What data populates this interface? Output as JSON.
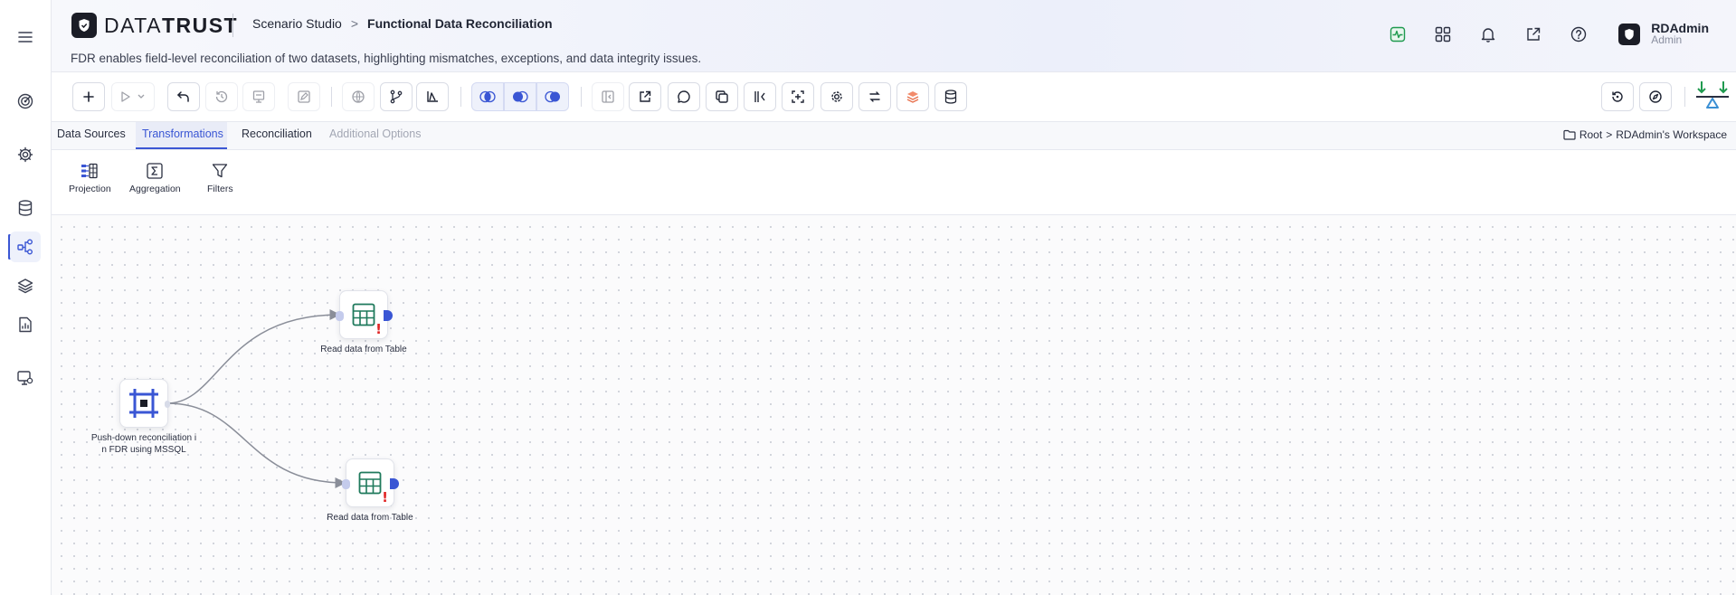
{
  "app": {
    "brand_light": "DATA",
    "brand_bold": "TRUST",
    "breadcrumb": [
      "Scenario Studio",
      "Functional Data Reconciliation"
    ],
    "breadcrumb_sep": ">",
    "subtitle": "FDR enables field-level reconciliation of two datasets, highlighting mismatches, exceptions, and data integrity issues."
  },
  "user": {
    "name": "RDAdmin",
    "role": "Admin"
  },
  "header_icons": [
    "activity-icon",
    "apps-grid-icon",
    "bell-icon",
    "external-link-icon",
    "help-icon"
  ],
  "rail": {
    "items": [
      "menu-icon",
      "target-icon",
      "settings-icon",
      "database-icon",
      "workflow-icon",
      "layers-icon",
      "report-icon",
      "monitor-settings-icon"
    ],
    "active": "workflow-icon"
  },
  "tabs": {
    "items": [
      "Data Sources",
      "Transformations",
      "Reconciliation",
      "Additional Options"
    ],
    "active": "Transformations",
    "disabled": [
      "Additional Options"
    ]
  },
  "workspace_path": {
    "root": "Root",
    "sep": ">",
    "workspace": "RDAdmin's Workspace"
  },
  "palette": [
    {
      "label": "Projection",
      "icon": "projection-icon"
    },
    {
      "label": "Aggregation",
      "icon": "sigma-icon"
    },
    {
      "label": "Filters",
      "icon": "filter-icon"
    }
  ],
  "canvas": {
    "nodes": [
      {
        "id": "source",
        "label_line1": "Push-down reconciliation i",
        "label_line2": "n FDR using MSSQL",
        "icon": "reconcile-node-icon"
      },
      {
        "id": "read1",
        "label": "Read data from Table",
        "icon": "table-icon",
        "warning": "!"
      },
      {
        "id": "read2",
        "label": "Read data from Table",
        "icon": "table-icon",
        "warning": "!"
      }
    ]
  },
  "colors": {
    "accent": "#3a56d4",
    "warning": "#e02424",
    "table_icon": "#1f7a5c",
    "brand_dark": "#1b1d26"
  }
}
